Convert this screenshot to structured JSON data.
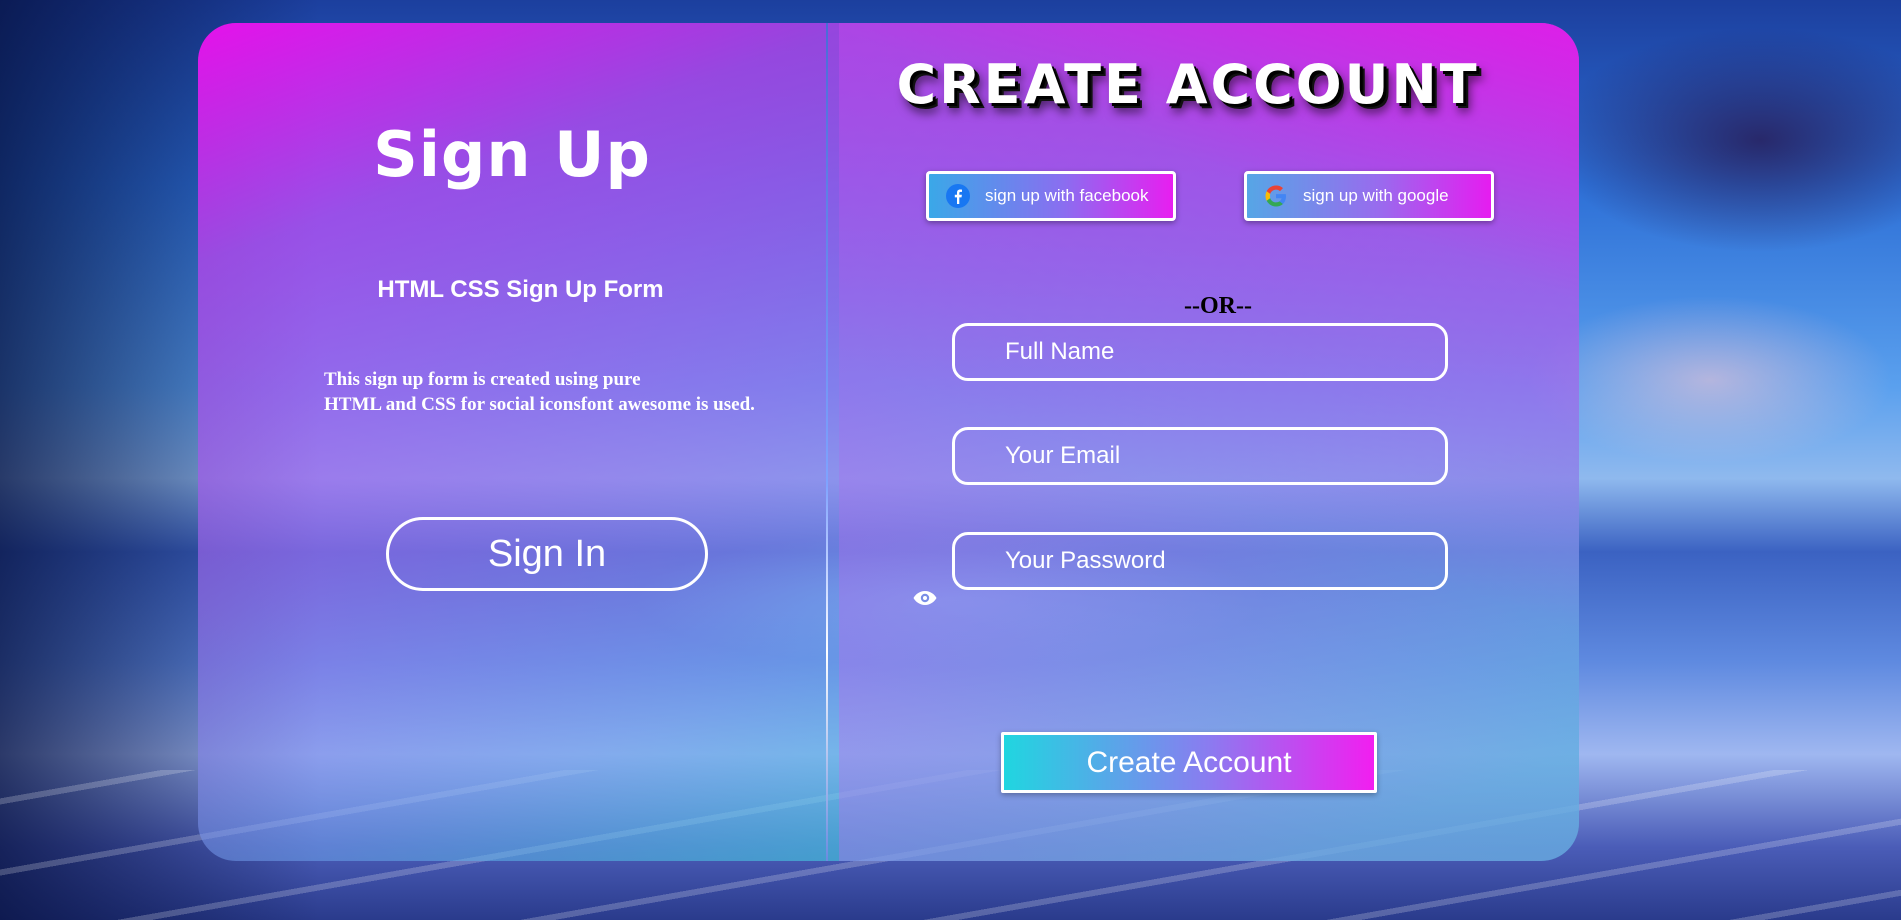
{
  "left": {
    "title": "Sign Up",
    "subtitle": "HTML CSS Sign Up Form",
    "description_line1": "This sign up form is created using pure",
    "description_line2": "HTML and CSS for social iconsfont awesome is used.",
    "signin_label": "Sign In"
  },
  "right": {
    "title": "CREATE ACCOUNT",
    "facebook_label": "sign up with facebook",
    "google_label": "sign up with google",
    "or_text": "--OR--",
    "fullname_placeholder": "Full Name",
    "email_placeholder": "Your Email",
    "password_placeholder": "Your Password",
    "create_label": "Create Account"
  },
  "icons": {
    "facebook": "facebook-icon",
    "google": "google-icon",
    "eye": "eye-icon"
  },
  "colors": {
    "accent_magenta": "#f010f0",
    "accent_cyan": "#28e0d8",
    "facebook_blue": "#1877f2",
    "text_white": "#ffffff"
  }
}
